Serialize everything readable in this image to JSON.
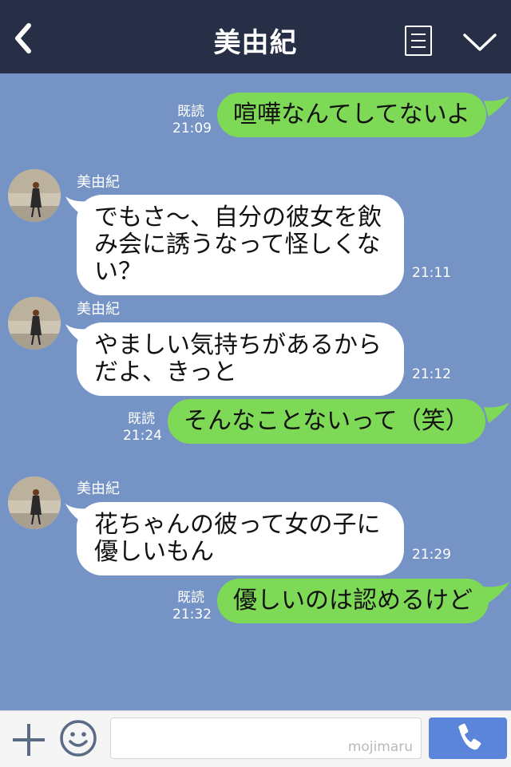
{
  "header": {
    "title": "美由紀",
    "back_icon": "chevron-left-icon",
    "menu_icon": "menu-icon",
    "collapse_icon": "chevron-down-icon"
  },
  "messages": [
    {
      "direction": "out",
      "text": "喧嘩なんてしてないよ",
      "read": "既読",
      "time": "21:09"
    },
    {
      "direction": "in",
      "sender": "美由紀",
      "text": "でもさ〜、自分の彼女を飲み会に誘うなって怪しくない？",
      "time": "21:11"
    },
    {
      "direction": "in",
      "sender": "美由紀",
      "text": "やましい気持ちがあるからだよ、きっと",
      "time": "21:12"
    },
    {
      "direction": "out",
      "text": "そんなことないって（笑）",
      "read": "既読",
      "time": "21:24"
    },
    {
      "direction": "in",
      "sender": "美由紀",
      "text": "花ちゃんの彼って女の子に優しいもん",
      "time": "21:29"
    },
    {
      "direction": "out",
      "text": "優しいのは認めるけど",
      "read": "既読",
      "time": "21:32"
    }
  ],
  "footer": {
    "plus_icon": "plus-icon",
    "emoji_icon": "smiley-icon",
    "input_value": "",
    "watermark": "mojimaru",
    "call_icon": "phone-icon"
  },
  "colors": {
    "header_bg": "#262f45",
    "chat_bg": "#7594c5",
    "outgoing_bubble": "#7ed957",
    "incoming_bubble": "#ffffff",
    "call_button": "#5b84db"
  }
}
